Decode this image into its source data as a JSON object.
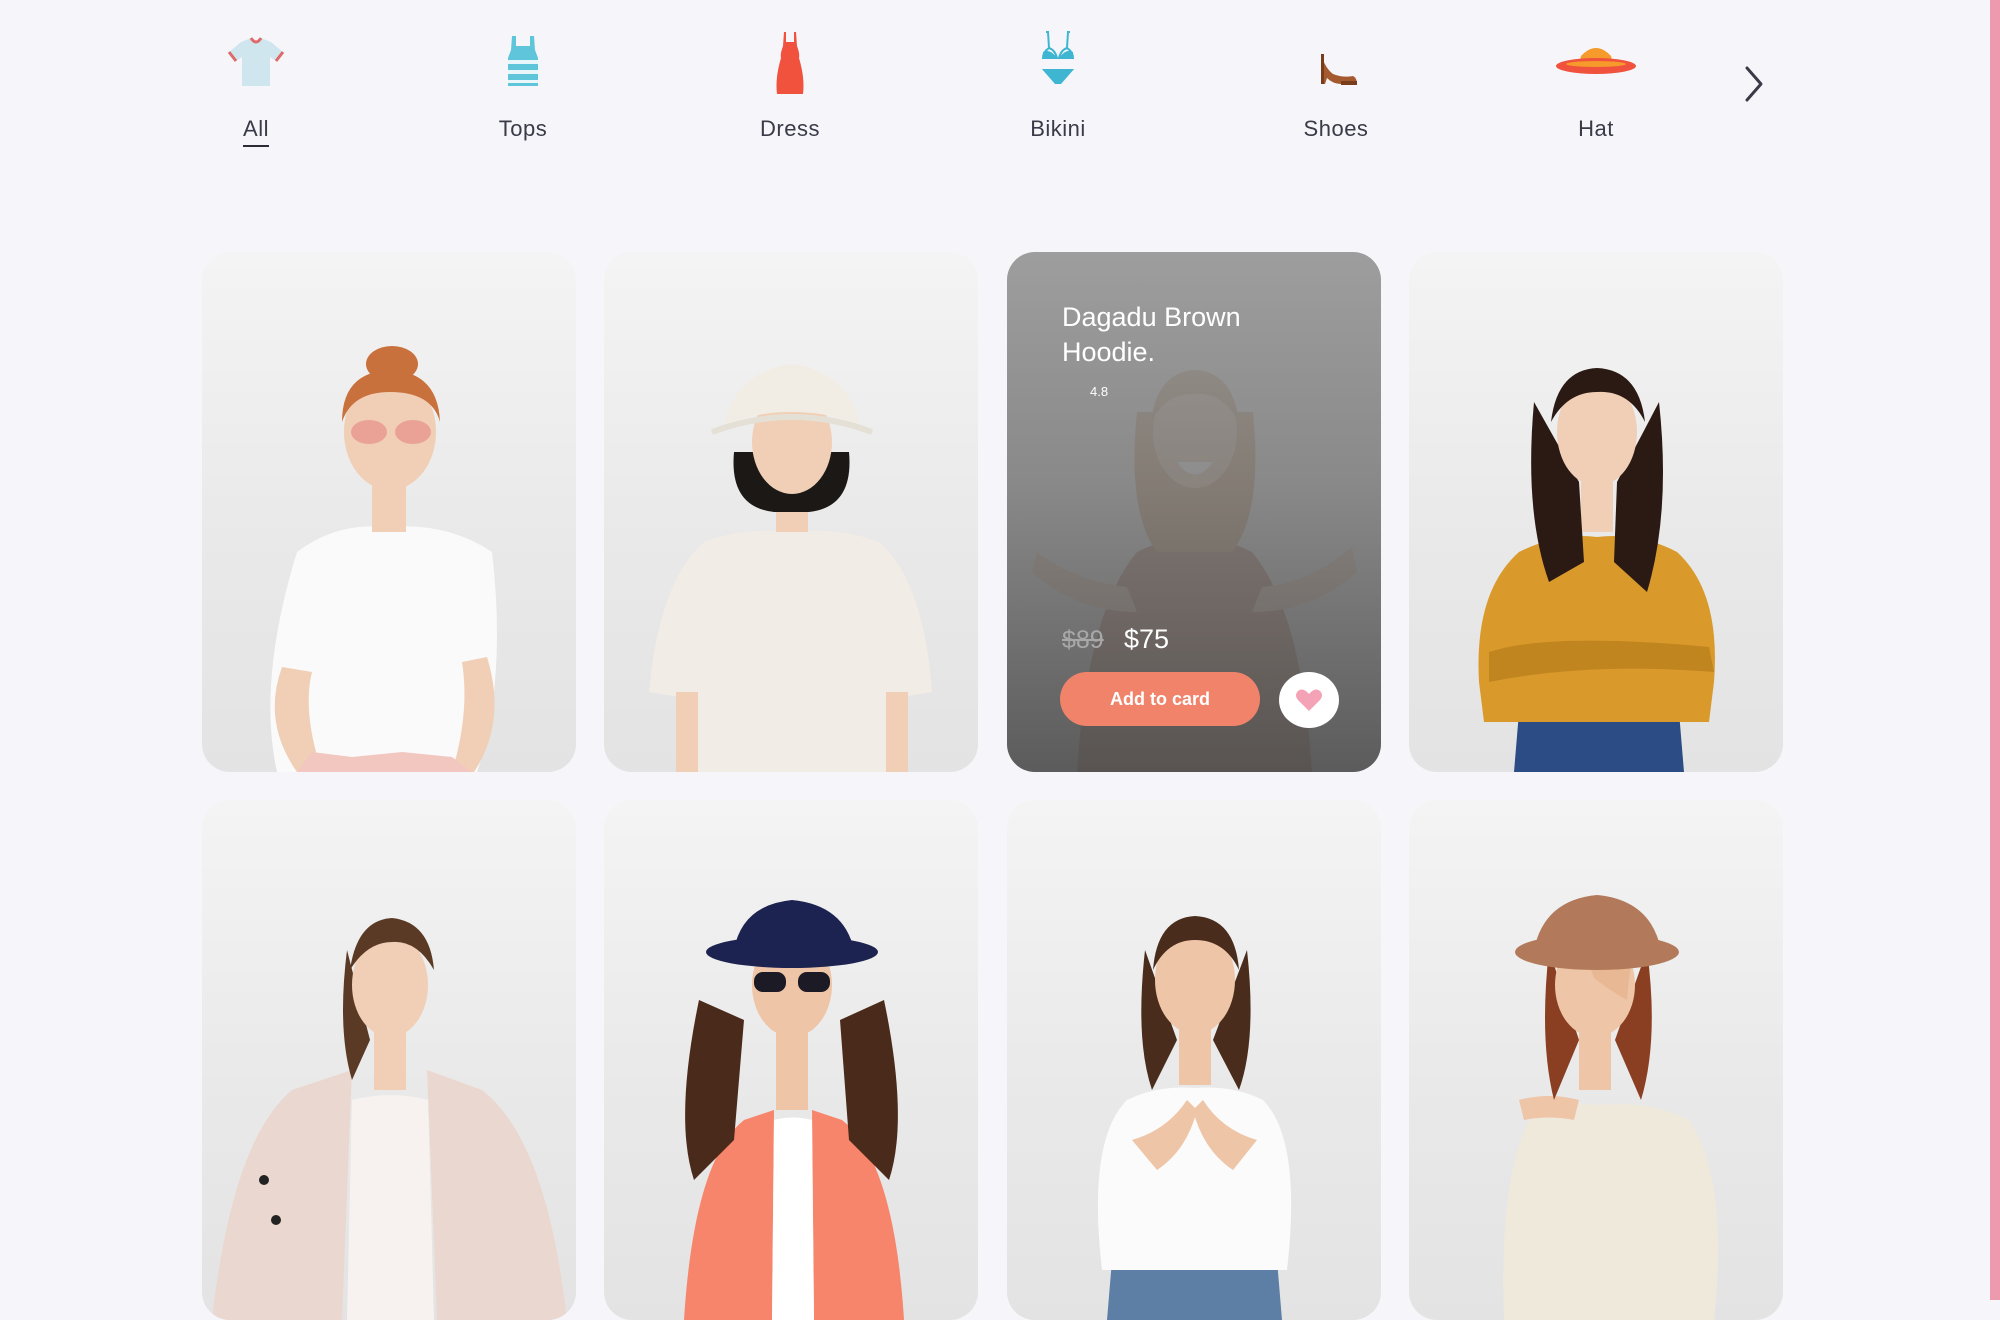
{
  "categories": [
    {
      "label": "All",
      "icon": "tshirt-icon",
      "active": true
    },
    {
      "label": "Tops",
      "icon": "tank-top-icon",
      "active": false
    },
    {
      "label": "Dress",
      "icon": "dress-icon",
      "active": false
    },
    {
      "label": "Bikini",
      "icon": "bikini-icon",
      "active": false
    },
    {
      "label": "Shoes",
      "icon": "high-heel-icon",
      "active": false
    },
    {
      "label": "Hat",
      "icon": "hat-icon",
      "active": false
    }
  ],
  "next_icon": "chevron-right-icon",
  "featured_product": {
    "name": "Dagadu Brown Hoodie.",
    "rating": "4.8",
    "old_price": "$89",
    "price": "$75",
    "add_to_cart_label": "Add to card",
    "favorite_icon": "heart-icon"
  },
  "products": [
    {
      "model": "Red-haired woman with sunglasses in white t-shirt"
    },
    {
      "model": "Woman in white bucket hat and white t-shirt"
    },
    {
      "model": "Smiling woman in brown hoodie"
    },
    {
      "model": "Woman in mustard knit sweater and jeans"
    },
    {
      "model": "Woman in beige coat"
    },
    {
      "model": "Woman in navy hat, sunglasses and coral jacket"
    },
    {
      "model": "Woman in white t-shirt clapping hands"
    },
    {
      "model": "Woman in brown hat and cream knit sweater"
    }
  ],
  "colors": {
    "accent": "#f1836b",
    "heart": "#f4a3b6",
    "background": "#f6f6fa",
    "stripe": "#ee9aae"
  }
}
